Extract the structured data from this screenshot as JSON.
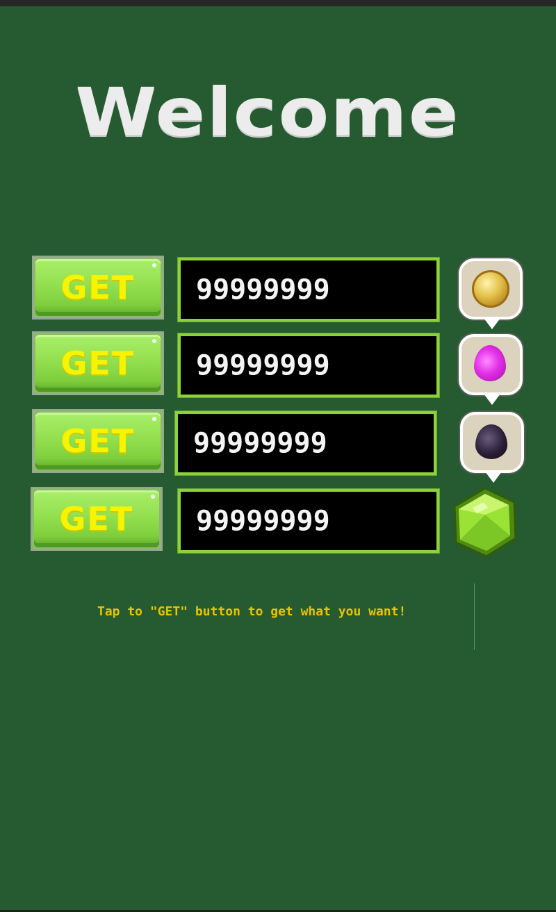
{
  "screen": {
    "title": "Welcome",
    "hint": "Tap to \"GET\" button to get what you want!"
  },
  "resources": [
    {
      "button_label": "GET",
      "value": "99999999",
      "icon": "gold-coin-icon"
    },
    {
      "button_label": "GET",
      "value": "99999999",
      "icon": "elixir-drop-icon"
    },
    {
      "button_label": "GET",
      "value": "99999999",
      "icon": "dark-elixir-drop-icon"
    },
    {
      "button_label": "GET",
      "value": "99999999",
      "icon": "gem-icon"
    }
  ],
  "colors": {
    "background": "#265b31",
    "button_green": "#93e04f",
    "button_text": "#f6f400",
    "field_border": "#8cd33a",
    "hint_text": "#e7c300"
  }
}
